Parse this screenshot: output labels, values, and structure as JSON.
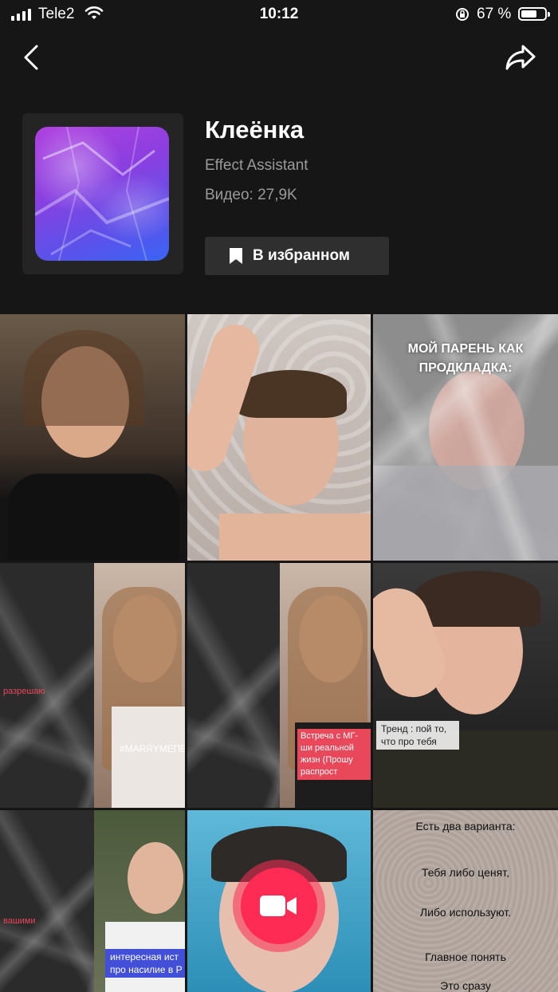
{
  "status_bar": {
    "carrier": "Tele2",
    "time": "10:12",
    "battery_percent": "67 %",
    "battery_level": 0.67,
    "signal_bars": 4
  },
  "nav": {
    "back_icon": "chevron-left-icon",
    "share_icon": "share-arrow-icon"
  },
  "effect": {
    "title": "Клеёнка",
    "author": "Effect Assistant",
    "videos": "Видео: 27,9K",
    "favorite_label": "В избранном",
    "favorite_icon": "bookmark-icon"
  },
  "grid": {
    "tiles": [
      {
        "caption": ""
      },
      {
        "caption": ""
      },
      {
        "caption": "МОЙ ПАРЕНЬ КАК ПРОДКЛАДКА:"
      },
      {
        "caption": "разрешаю",
        "tag": "#MARRYMEПЕ"
      },
      {
        "caption": "Встреча с МГ-ши реальной жизн (Прошу распрост"
      },
      {
        "caption": "Тренд : пой то, что про тебя"
      },
      {
        "caption": "вашими",
        "caption2": "интересная ист про насилие в Р"
      },
      {
        "caption": ""
      },
      {
        "lines": [
          "Есть два варианта:",
          "Тебя либо ценят,",
          "Либо используют.",
          "Главное понять",
          "Это сразу"
        ]
      }
    ]
  },
  "record": {
    "icon": "video-camera-icon"
  },
  "colors": {
    "background": "#161616",
    "record_accent": "#fe2c55"
  }
}
